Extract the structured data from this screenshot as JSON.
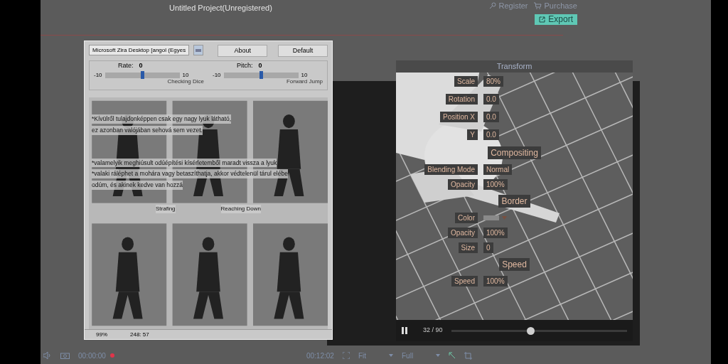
{
  "app": {
    "title": "Untitled Project(Unregistered)",
    "register": "Register",
    "purchase": "Purchase",
    "export": "Export"
  },
  "tts_window": {
    "voice": "Microsoft Zira Desktop [angol (Egyes",
    "buttons": [
      "About",
      "Default"
    ],
    "sliders": [
      {
        "label": "Rate:",
        "value": "0",
        "min": "-10",
        "max": "10",
        "level": 0.5
      },
      {
        "label": "Pitch:",
        "value": "0",
        "min": "-10",
        "max": "10",
        "level": 0.5
      }
    ],
    "clip_labels": [
      "Checking Dice",
      "Forward Jump"
    ],
    "text_lines": [
      "*Kívülről tulajdonképpen csak egy nagy lyuk látható,",
      "ez azonban valójában sehová sem vezet.",
      "*valamelyik meghiúsult odúépítési kísérletemből maradt vissza a lyuk",
      "*valaki ráléphet a mohára vagy betaszíthatja, akkor védtelenül tárul elébe",
      "odúm, és akinek kedve van hozzá"
    ],
    "thumb_labels": [
      "Strafing",
      "Reaching Down"
    ],
    "status": [
      "99%",
      "248: 57"
    ]
  },
  "properties": {
    "sections": [
      {
        "title": "Transform",
        "rows": [
          {
            "kind": "value",
            "label": "Scale",
            "value": "80%"
          },
          {
            "kind": "value",
            "label": "Rotation",
            "value": "0.0"
          },
          {
            "kind": "value",
            "label": "Position X",
            "value": "0.0"
          },
          {
            "kind": "value",
            "label": "Y",
            "value": "0.0"
          }
        ]
      },
      {
        "title": "Compositing",
        "rows": [
          {
            "kind": "value",
            "label": "Blending Mode",
            "value": "Normal"
          },
          {
            "kind": "value",
            "label": "Opacity",
            "value": "100%"
          }
        ]
      },
      {
        "title": "Border",
        "rows": [
          {
            "kind": "swatch",
            "label": "Color",
            "color": "#8a8a8a"
          },
          {
            "kind": "value",
            "label": "Opacity",
            "value": "100%"
          },
          {
            "kind": "value",
            "label": "Size",
            "value": "0"
          }
        ]
      },
      {
        "title": "Speed",
        "rows": [
          {
            "kind": "value",
            "label": "Speed",
            "value": "100%"
          }
        ]
      }
    ]
  },
  "player": {
    "frame": "32 / 90",
    "level": 0.45
  },
  "toolbar": {
    "time_left": "00:00:00",
    "recording": true,
    "time_right": "00:12:02",
    "fit": "Fit",
    "quality": "Full"
  }
}
